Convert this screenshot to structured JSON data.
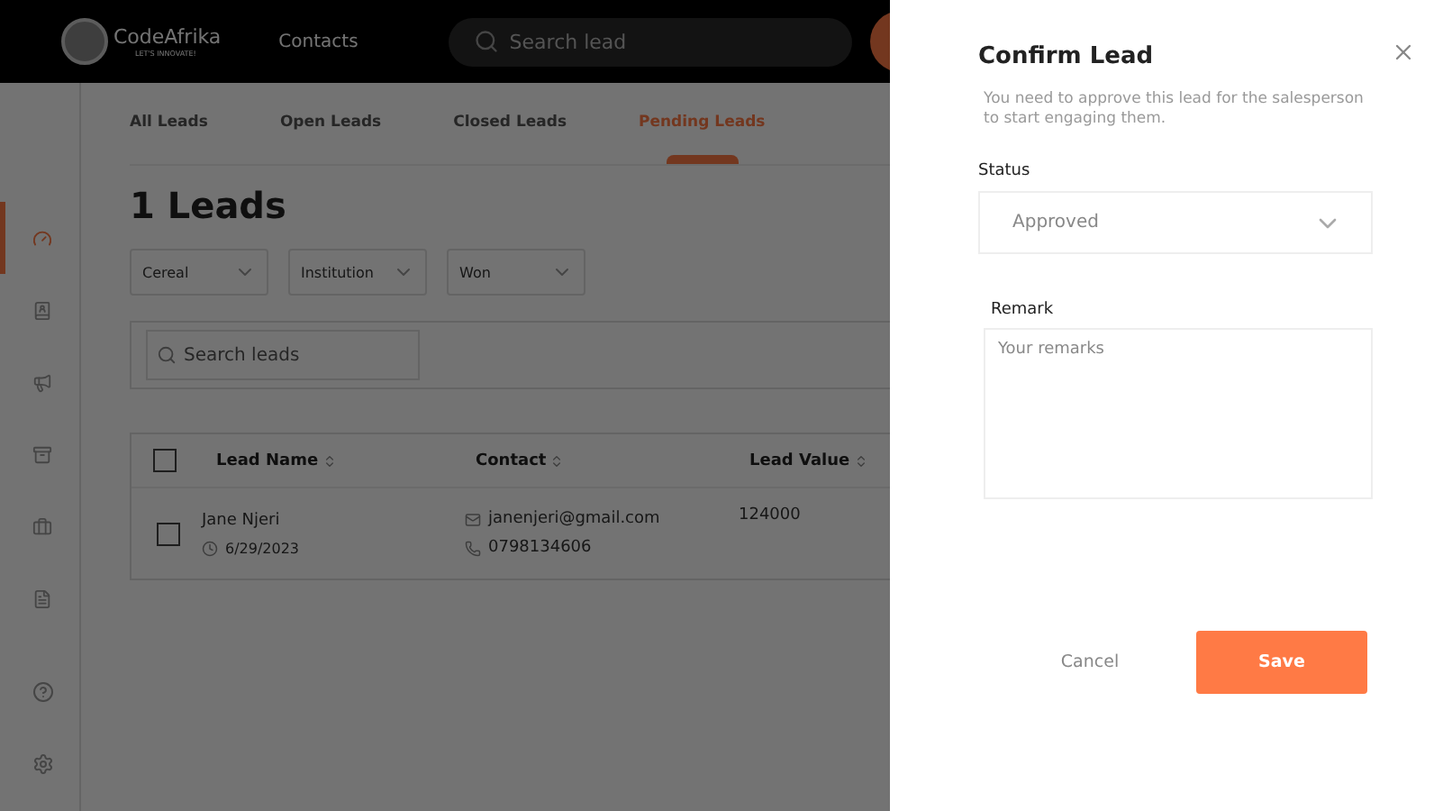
{
  "header": {
    "logo": {
      "name": "CodeAfrika",
      "tagline": "LET'S INNOVATE!"
    },
    "section": "Contacts",
    "search": {
      "placeholder": "Search lead"
    }
  },
  "sidebar": {
    "items": [
      {
        "selected": true
      },
      {
        "selected": false
      },
      {
        "selected": false
      },
      {
        "selected": false
      },
      {
        "selected": false
      },
      {
        "selected": false
      }
    ]
  },
  "tabs": [
    {
      "label": "All Leads",
      "selected": false
    },
    {
      "label": "Open Leads",
      "selected": false
    },
    {
      "label": "Closed Leads",
      "selected": false
    },
    {
      "label": "Pending Leads",
      "selected": true
    }
  ],
  "title": "1 Leads",
  "filters": [
    "Cereal",
    "Institution",
    "Won"
  ],
  "lead_search": {
    "placeholder": "Search leads"
  },
  "table": {
    "all_checked": false,
    "columns": [
      "Lead Name",
      "Contact",
      "Lead Value"
    ],
    "rows": [
      {
        "name": "Jane Njeri",
        "date": "6/29/2023",
        "email": "janenjeri@gmail.com",
        "phone": "0798134606",
        "value": "124000",
        "checked": false
      }
    ]
  },
  "drawer": {
    "title": "Confirm Lead",
    "description": "You need to approve this lead for the salesperson to start engaging them.",
    "status_label": "Status",
    "status_value": "Approved",
    "remark_label": "Remark",
    "remark_placeholder": "Your remarks",
    "buttons": {
      "cancel": "Cancel",
      "save": "Save"
    }
  }
}
